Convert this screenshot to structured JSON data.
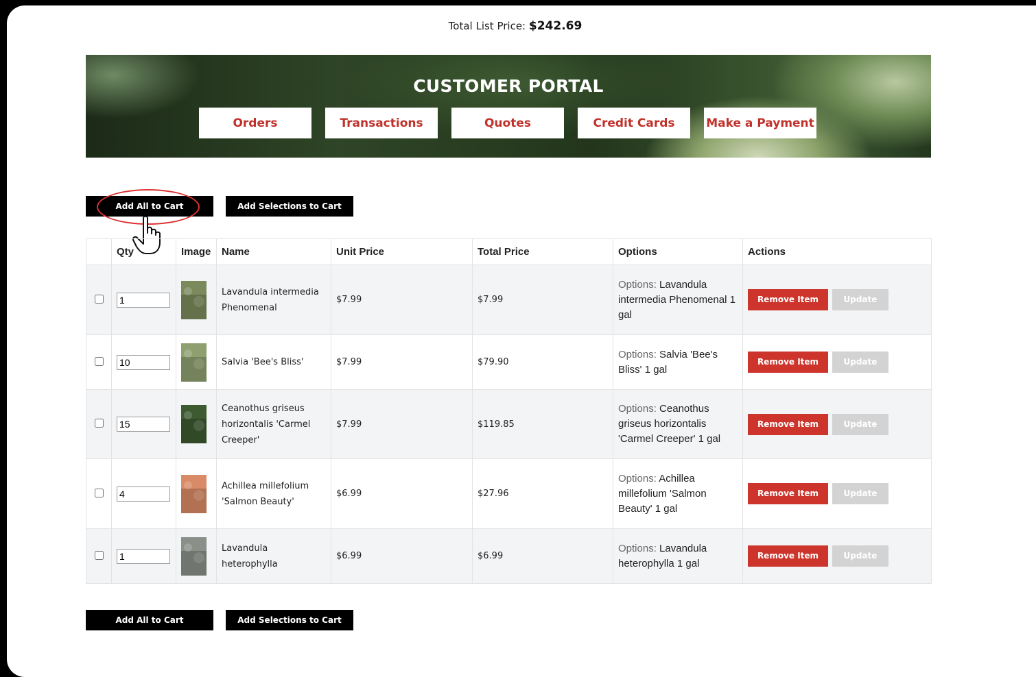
{
  "total": {
    "label": "Total List Price:",
    "value": "$242.69"
  },
  "banner": {
    "title": "CUSTOMER PORTAL",
    "nav": [
      "Orders",
      "Transactions",
      "Quotes",
      "Credit Cards",
      "Make a Payment"
    ]
  },
  "actions": {
    "add_all": "Add All to Cart",
    "add_selections": "Add Selections to Cart"
  },
  "table": {
    "headers": [
      "",
      "Qty",
      "Image",
      "Name",
      "Unit Price",
      "Total Price",
      "Options",
      "Actions"
    ],
    "options_prefix": "Options:",
    "remove_label": "Remove Item",
    "update_label": "Update",
    "rows": [
      {
        "qty": "1",
        "name": "Lavandula intermedia Phenomenal",
        "unit_price": "$7.99",
        "total_price": "$7.99",
        "options": "Lavandula intermedia Phenomenal 1 gal",
        "thumb_color": "#7a8a5c"
      },
      {
        "qty": "10",
        "name": "Salvia 'Bee's Bliss'",
        "unit_price": "$7.99",
        "total_price": "$79.90",
        "options": "Salvia 'Bee's Bliss' 1 gal",
        "thumb_color": "#8ea070"
      },
      {
        "qty": "15",
        "name": "Ceanothus griseus horizontalis 'Carmel Creeper'",
        "unit_price": "$7.99",
        "total_price": "$119.85",
        "options": "Ceanothus griseus horizontalis 'Carmel Creeper' 1 gal",
        "thumb_color": "#3e5a30"
      },
      {
        "qty": "4",
        "name": "Achillea millefolium 'Salmon Beauty'",
        "unit_price": "$6.99",
        "total_price": "$27.96",
        "options": "Achillea millefolium 'Salmon Beauty' 1 gal",
        "thumb_color": "#d98a66"
      },
      {
        "qty": "1",
        "name": "Lavandula heterophylla",
        "unit_price": "$6.99",
        "total_price": "$6.99",
        "options": "Lavandula heterophylla 1 gal",
        "thumb_color": "#8a8f88"
      }
    ]
  },
  "colors": {
    "accent": "#cc342c",
    "nav_text": "#c0312b",
    "update_disabled": "#d3d3d3"
  }
}
